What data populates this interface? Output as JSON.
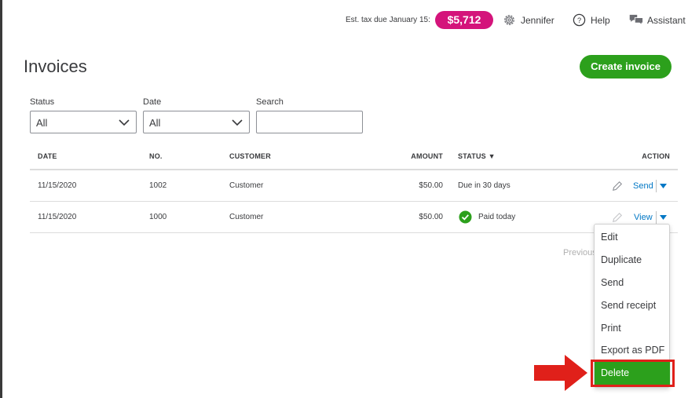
{
  "topbar": {
    "tax_label": "Est. tax due January 15:",
    "tax_amount": "$5,712",
    "user": "Jennifer",
    "help": "Help",
    "assistant": "Assistant"
  },
  "page": {
    "title": "Invoices",
    "create_button": "Create invoice"
  },
  "filters": {
    "status_label": "Status",
    "status_value": "All",
    "date_label": "Date",
    "date_value": "All",
    "search_label": "Search",
    "search_value": ""
  },
  "table": {
    "headers": {
      "date": "DATE",
      "no": "NO.",
      "customer": "CUSTOMER",
      "amount": "AMOUNT",
      "status": "STATUS ▼",
      "action": "ACTION"
    },
    "rows": [
      {
        "date": "11/15/2020",
        "no": "1002",
        "customer": "Customer",
        "amount": "$50.00",
        "status": "Due in 30 days",
        "action": "Send"
      },
      {
        "date": "11/15/2020",
        "no": "1000",
        "customer": "Customer",
        "amount": "$50.00",
        "status": "Paid today",
        "action": "View"
      }
    ]
  },
  "pager": {
    "previous": "Previous"
  },
  "menu": {
    "items": [
      "Edit",
      "Duplicate",
      "Send",
      "Send receipt",
      "Print",
      "Export as PDF",
      "Delete"
    ]
  },
  "colors": {
    "brand_green": "#2ca01c",
    "tax_pink": "#d4147b",
    "link_blue": "#0077c5",
    "highlight_red": "#e0201a"
  }
}
